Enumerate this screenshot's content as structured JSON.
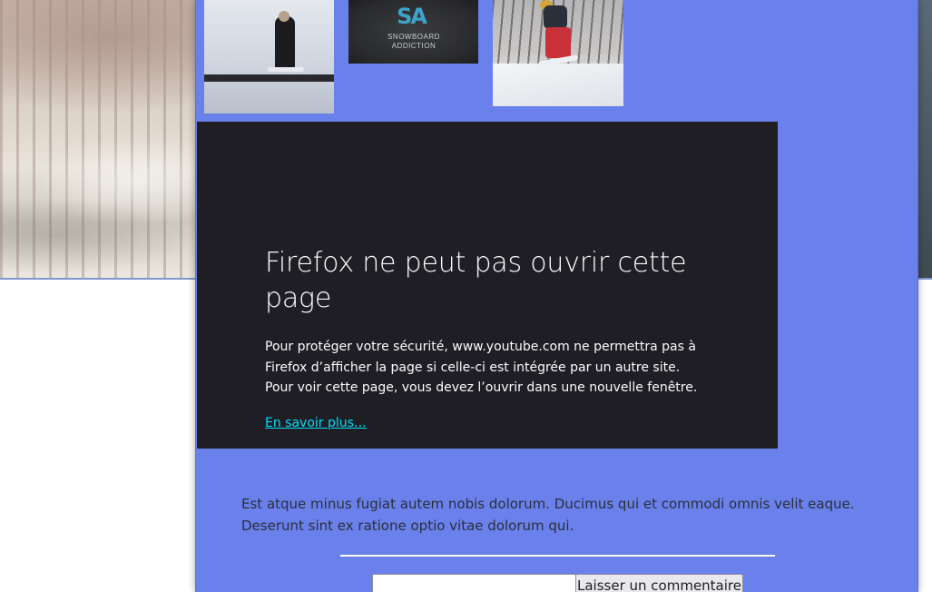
{
  "thumbnails": [
    {
      "icon": "snowboarder-rail-photo"
    },
    {
      "icon": "snowboard-addiction-logo",
      "logo_mark": "SA",
      "logo_text_1": "SNOWBOARD",
      "logo_text_2": "ADDICTION"
    },
    {
      "icon": "snowboarder-jump-photo"
    }
  ],
  "error_frame": {
    "title": "Firefox ne peut pas ouvrir cette page",
    "body": "Pour protéger votre sécurité, www.youtube.com ne permettra pas à Firefox d’afficher la page si celle-ci est intégrée par un autre site. Pour voir cette page, vous devez l’ouvrir dans une nouvelle fenêtre.",
    "link_text": "En savoir plus…"
  },
  "excerpt": "Est atque minus fugiat autem nobis dolorum. Ducimus qui et commodi omnis velit eaque. Deserunt sint ex ratione optio vitae dolorum qui.",
  "comment_form": {
    "input_value": "",
    "button_label": "Laisser un commentaire"
  },
  "colors": {
    "content_bg": "#6a80ea",
    "frame_bg": "#1f1e24",
    "link": "#00ddff"
  }
}
